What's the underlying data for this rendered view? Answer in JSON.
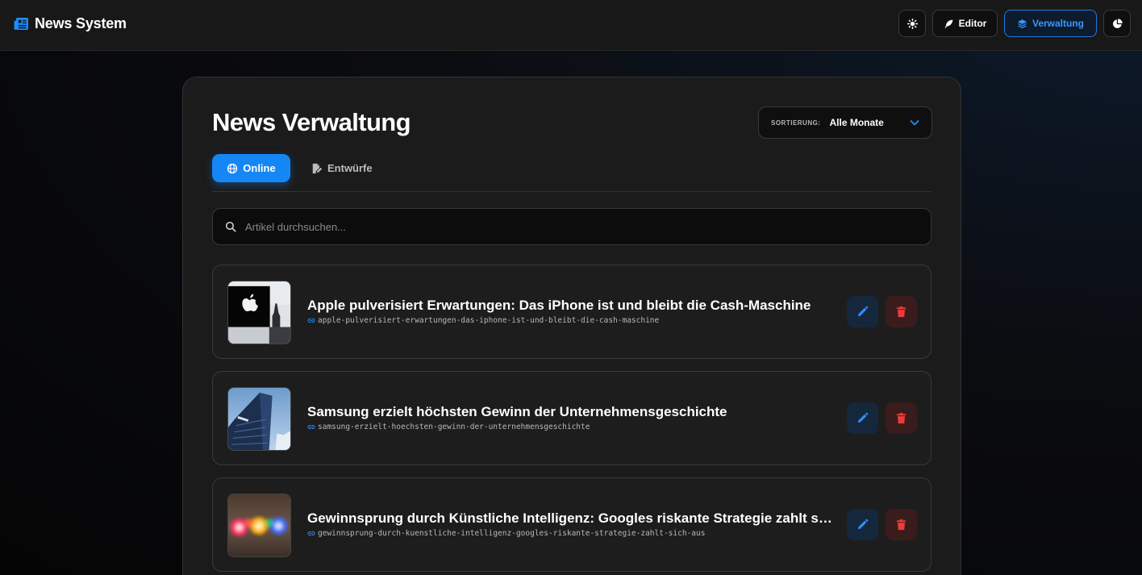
{
  "header": {
    "brand_title": "News System",
    "nav": {
      "editor_label": "Editor",
      "verwaltung_label": "Verwaltung"
    },
    "icons": [
      "newspaper-icon",
      "sun-icon",
      "feather-icon",
      "layers-icon",
      "pie-chart-icon"
    ]
  },
  "main": {
    "title": "News Verwaltung",
    "sort": {
      "label": "SORTIERUNG:",
      "value": "Alle Monate"
    },
    "tabs": [
      {
        "label": "Online",
        "icon": "globe-icon",
        "active": true
      },
      {
        "label": "Entwürfe",
        "icon": "file-edit-icon",
        "active": false
      }
    ],
    "search": {
      "value": "",
      "placeholder": "Artikel durchsuchen..."
    },
    "articles": [
      {
        "title": "Apple pulverisiert Erwartungen: Das iPhone ist und bleibt die Cash-Maschine",
        "slug": "apple-pulverisiert-erwartungen-das-iphone-ist-und-bleibt-die-cash-maschine"
      },
      {
        "title": "Samsung erzielt höchsten Gewinn der Unternehmensgeschichte",
        "slug": "samsung-erzielt-hoechsten-gewinn-der-unternehmensgeschichte"
      },
      {
        "title": "Gewinnsprung durch Künstliche Intelligenz: Googles riskante Strategie zahlt sich aus",
        "slug": "gewinnsprung-durch-kuenstliche-intelligenz-googles-riskante-strategie-zahlt-sich-aus"
      }
    ]
  },
  "colors": {
    "accent": "#1587f5",
    "danger": "#ef3b3b",
    "card_bg": "#1b1b1c"
  }
}
